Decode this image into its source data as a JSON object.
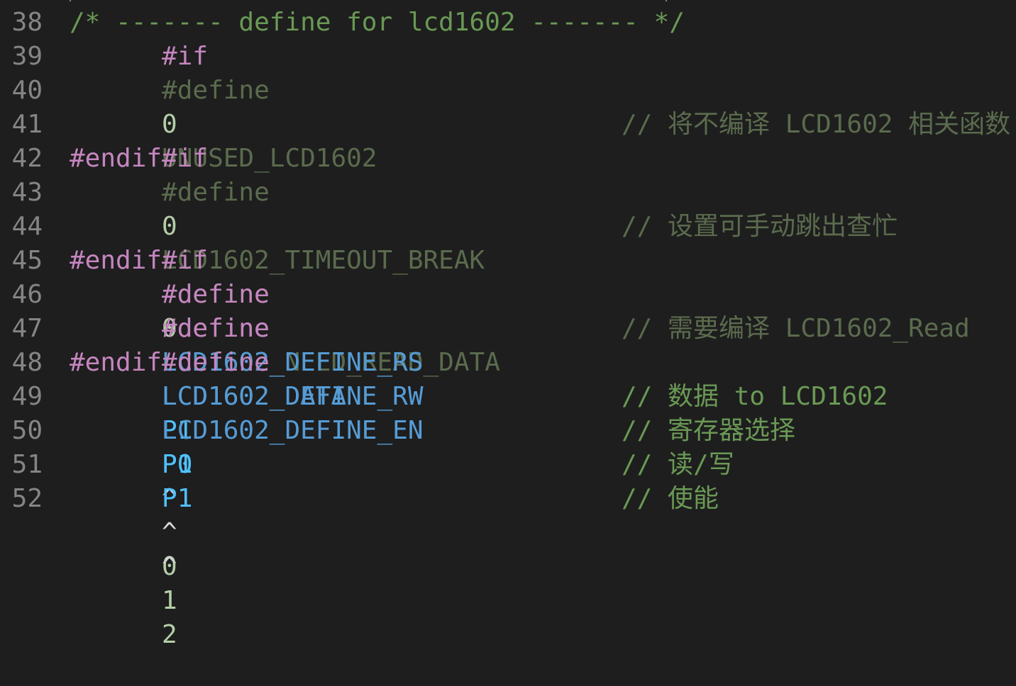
{
  "colors": {
    "background": "#1e1e1e",
    "line_number": "#858585",
    "comment": "#6a9955",
    "directive": "#c586c0",
    "number": "#b5cea8",
    "macro_name": "#569cd6",
    "port": "#4fc1ff",
    "inactive": "#5b6b4e",
    "plain": "#d4d4d4"
  },
  "editor": {
    "lines": [
      {
        "num": "38",
        "text": "/* ------- define for lcd1602 ------- */"
      },
      {
        "num": "39",
        "text": ""
      },
      {
        "num": "40",
        "directive": "#if",
        "value": "0"
      },
      {
        "num": "41",
        "directive": "#define",
        "name": "UNUSED_LCD1602",
        "comment": "// 将不编译 LCD1602 相关函数"
      },
      {
        "num": "42",
        "directive": "#endif"
      },
      {
        "num": "43",
        "directive": "#if",
        "value": "0"
      },
      {
        "num": "44",
        "directive": "#define",
        "name": "LCD1602_TIMEOUT_BREAK",
        "comment": "// 设置可手动跳出查忙"
      },
      {
        "num": "45",
        "directive": "#endif"
      },
      {
        "num": "46",
        "directive": "#if",
        "value": "0"
      },
      {
        "num": "47",
        "directive": "#define",
        "name": "LCD1602_NEED_READ_DATA",
        "comment": "// 需要编译 LCD1602_Read"
      },
      {
        "num": "48",
        "directive": "#endif"
      },
      {
        "num": "49",
        "directive": "#define",
        "name": "LCD1602_DATA",
        "port": "P0",
        "comment": "// 数据 to LCD1602"
      },
      {
        "num": "50",
        "directive": "#define",
        "name": "LCD1602_DEFINE_RS",
        "port": "P1",
        "op": "^",
        "bit": "0",
        "comment": "// 寄存器选择"
      },
      {
        "num": "51",
        "directive": "#define",
        "name": "LCD1602_DEFINE_RW",
        "port": "P1",
        "op": "^",
        "bit": "1",
        "comment": "// 读/写"
      },
      {
        "num": "52",
        "directive": "#define",
        "name": "LCD1602_DEFINE_EN",
        "port": "P1",
        "op": "^",
        "bit": "2",
        "comment": "// 使能"
      }
    ]
  }
}
